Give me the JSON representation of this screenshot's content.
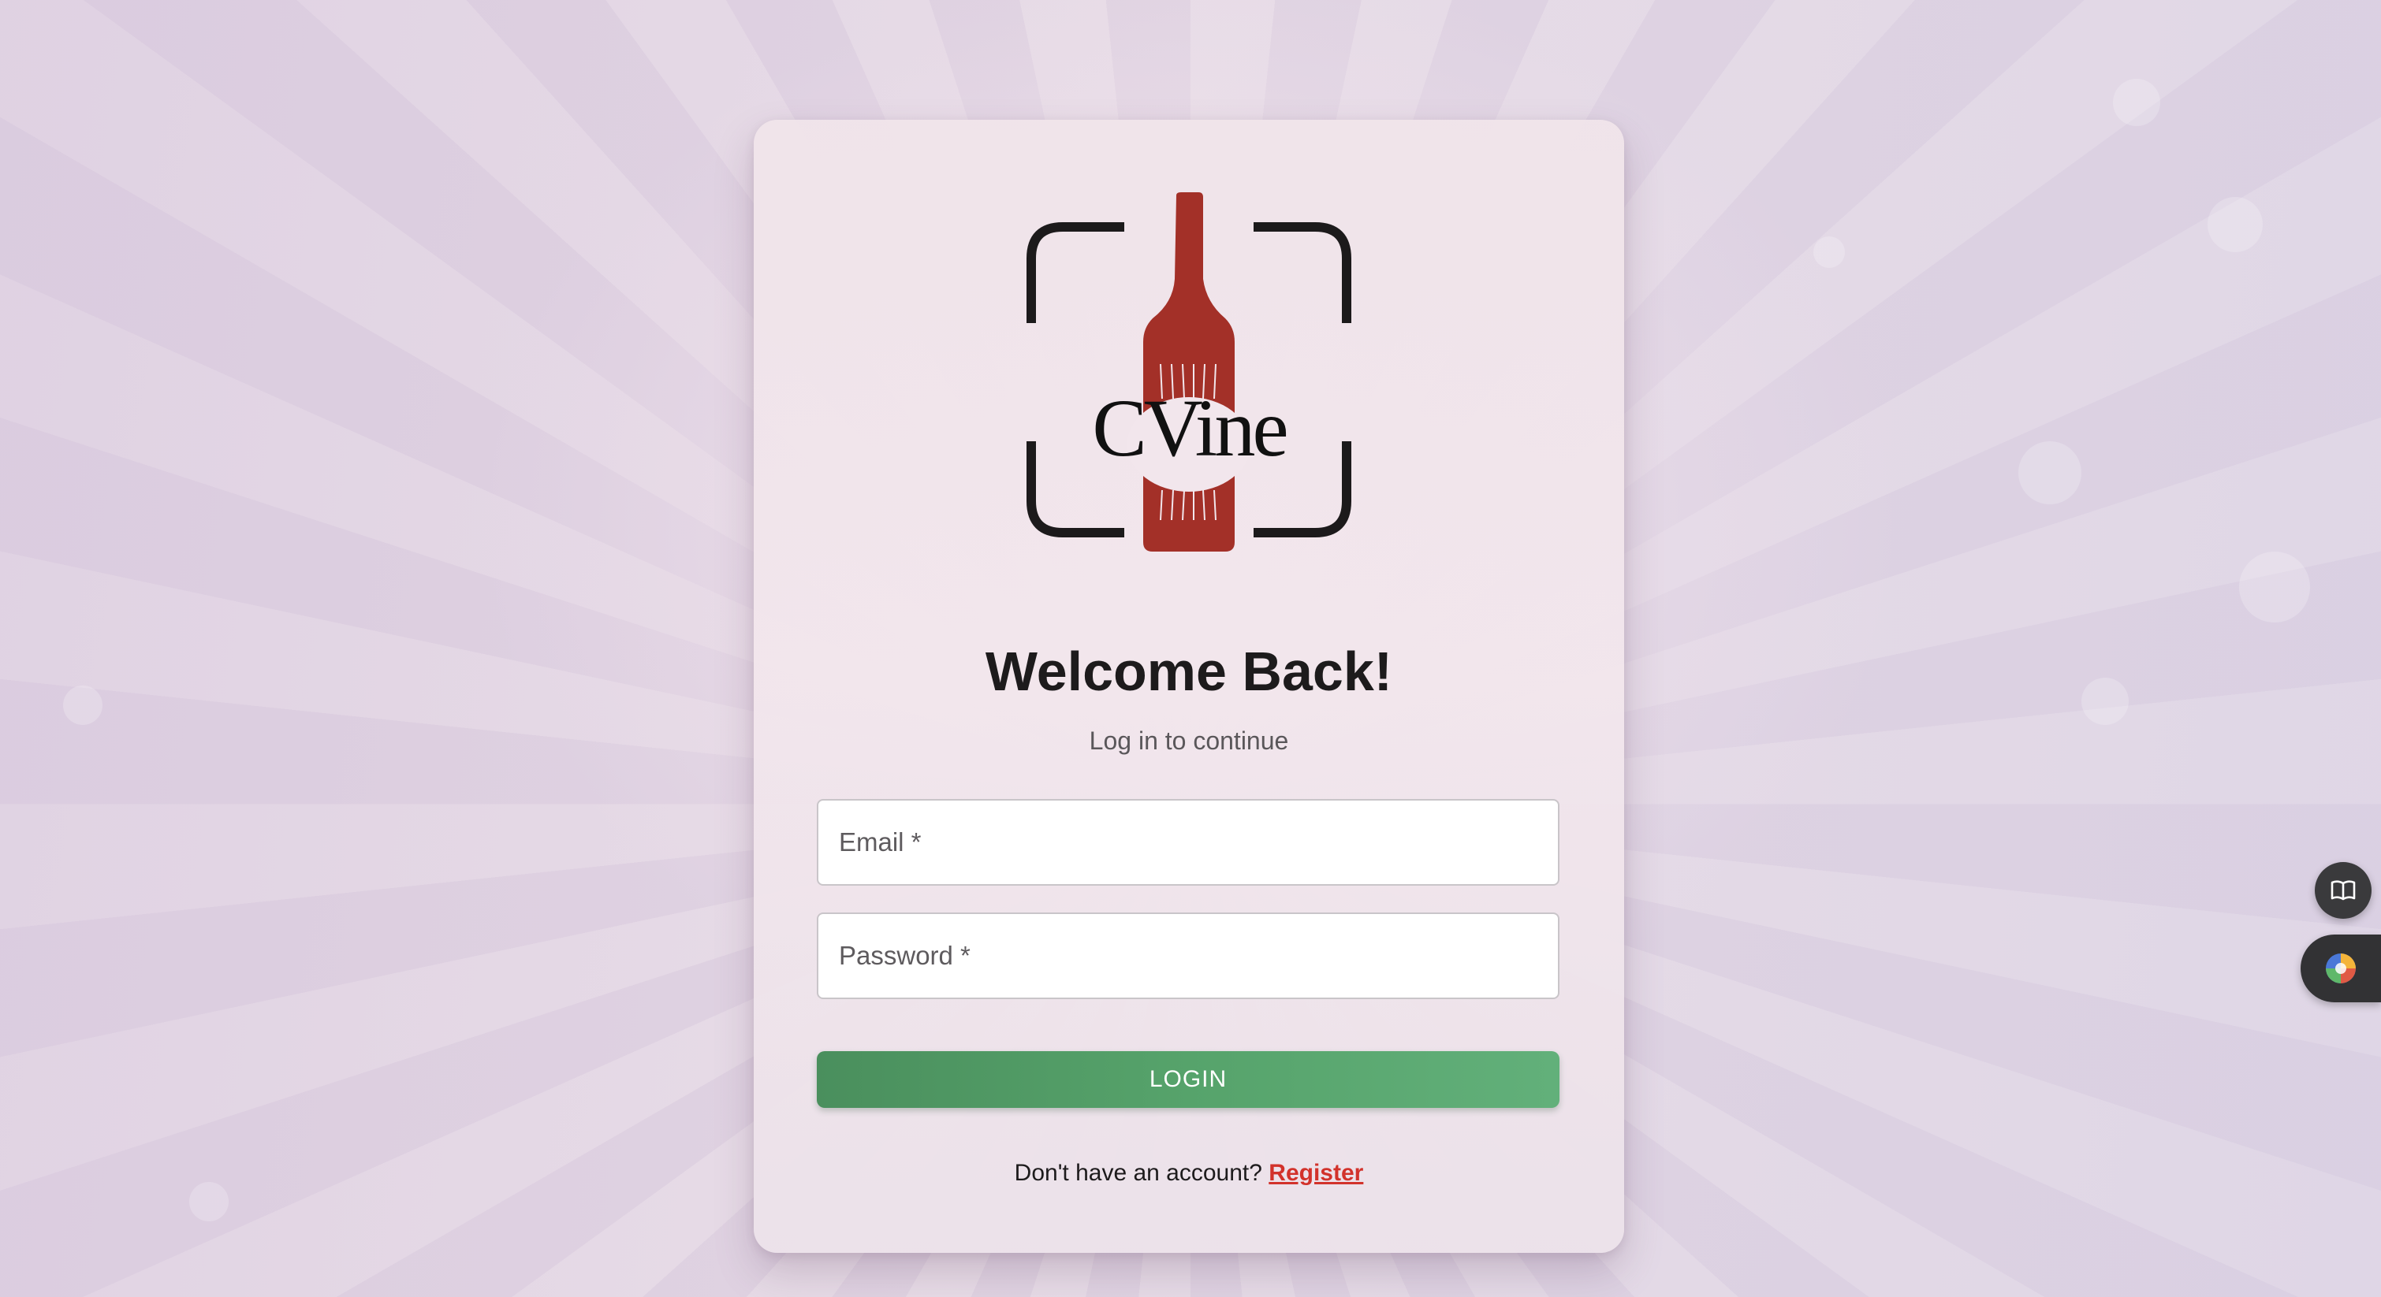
{
  "logo": {
    "brand_text": "CVine"
  },
  "login": {
    "title": "Welcome Back!",
    "subtitle": "Log in to continue",
    "email_label": "Email *",
    "password_label": "Password *",
    "login_button": "LOGIN",
    "register_prompt": "Don't have an account?",
    "register_link": "Register"
  },
  "side_widgets": {
    "reader_icon": "book-open-icon",
    "extension_icon": "color-wheel-icon"
  },
  "colors": {
    "brand_wine": "#a33028",
    "login_button": "#56a36b",
    "register_link": "#d2322b"
  }
}
